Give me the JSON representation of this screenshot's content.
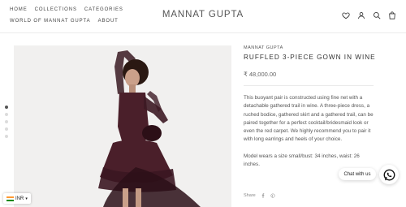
{
  "header": {
    "nav_top": [
      "HOME",
      "COLLECTIONS",
      "CATEGORIES"
    ],
    "nav_bottom": [
      "WORLD OF MANNAT GUPTA",
      "ABOUT"
    ],
    "logo": "MANNAT GUPTA",
    "icons": [
      "heart-icon",
      "account-icon",
      "search-icon",
      "cart-bag-icon"
    ]
  },
  "gallery": {
    "dot_count": 5,
    "active_index": 0
  },
  "product": {
    "brand": "MANNAT GUPTA",
    "title": "RUFFLED 3-PIECE GOWN IN WINE",
    "price": "₹ 48,000.00",
    "description": "This buoyant pair is constructed using fine net with a detachable gathered trail in wine. A three-piece dress, a ruched bodice, gathered skirt and a gathered trail, can be paired together for a perfect cocktail/bridesmaid look or even the red carpet. We highly recommend you to pair it with long earrings and heels of your choice.",
    "size_note": "Model wears a size small/bust: 34 inches, waist: 26 inches."
  },
  "share": {
    "label": "Share",
    "icons": [
      "facebook-icon",
      "pinterest-icon"
    ]
  },
  "chat": {
    "label": "Chat with us",
    "icon": "whatsapp-icon"
  },
  "currency": {
    "code": "INR",
    "flag": "india-flag-icon"
  },
  "colors": {
    "gown": "#4a1f2a",
    "background": "#f1f0ef",
    "whatsapp": "#111111"
  }
}
